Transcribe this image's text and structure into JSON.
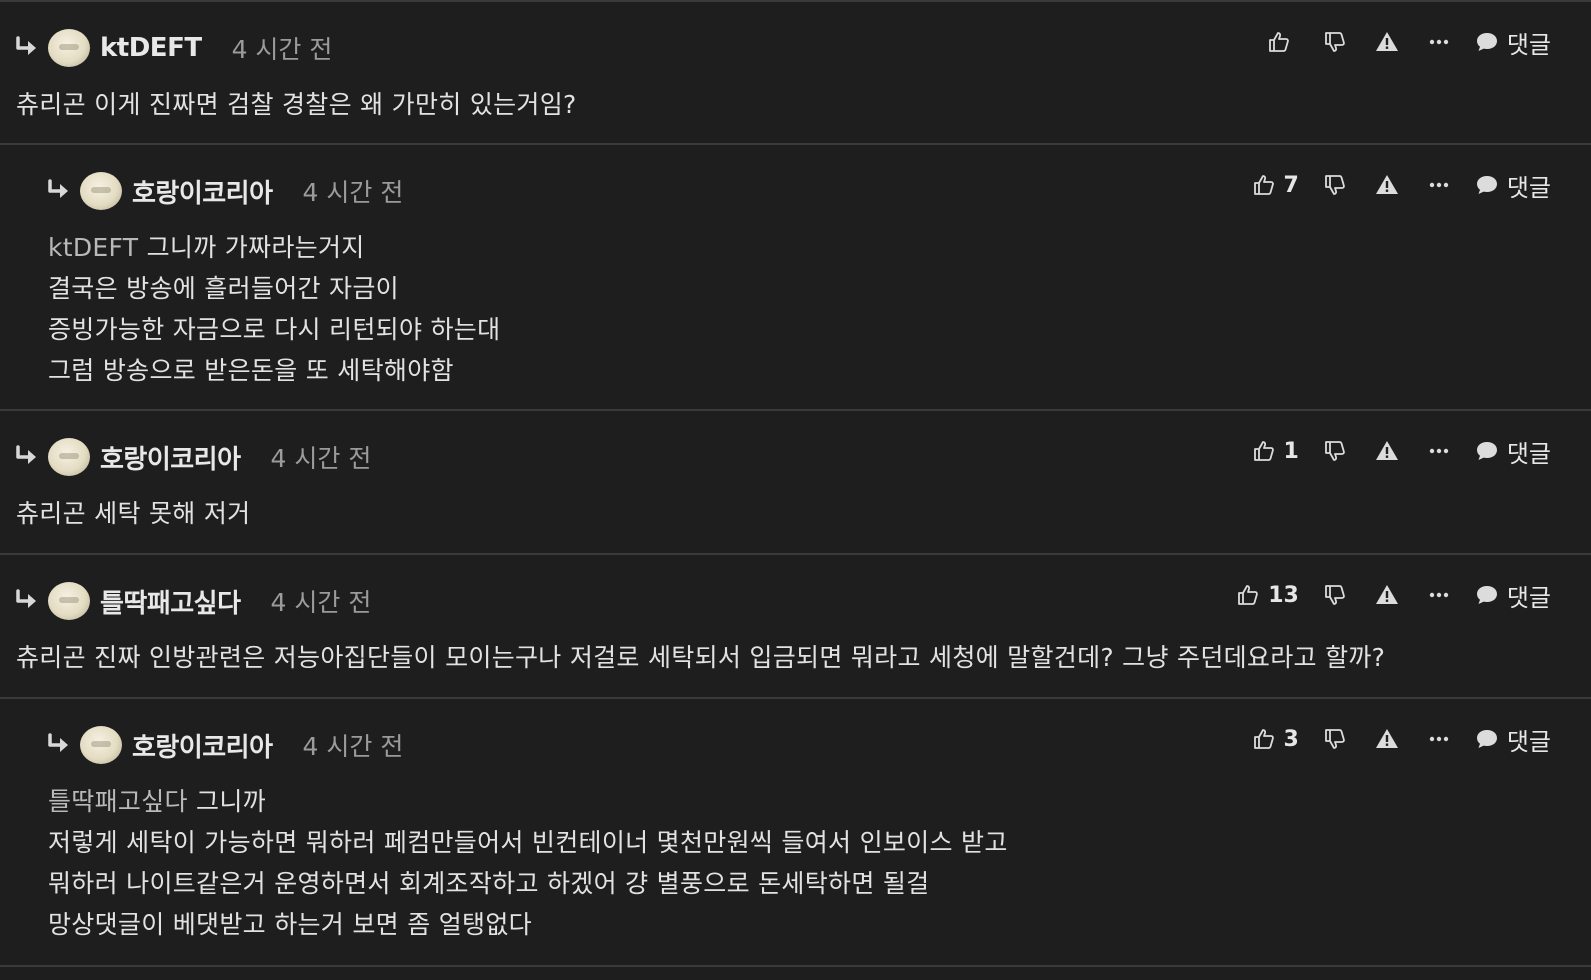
{
  "comments": [
    {
      "author": "ktDEFT",
      "time": "4 시간 전",
      "likes": "",
      "reply_label": "댓글",
      "mention": "",
      "lines": [
        "츄리곤 이게 진짜면 검찰 경찰은 왜 가만히 있는거임?"
      ]
    },
    {
      "author": "호랑이코리아",
      "time": "4 시간 전",
      "likes": "7",
      "reply_label": "댓글",
      "mention": "ktDEFT",
      "lines": [
        " 그니까 가짜라는거지",
        "결국은 방송에 흘러들어간 자금이",
        "증빙가능한 자금으로 다시 리턴되야 하는대",
        "그럼 방송으로 받은돈을 또 세탁해야함"
      ]
    },
    {
      "author": "호랑이코리아",
      "time": "4 시간 전",
      "likes": "1",
      "reply_label": "댓글",
      "mention": "",
      "lines": [
        "츄리곤 세탁 못해 저거"
      ]
    },
    {
      "author": "틀딱패고싶다",
      "time": "4 시간 전",
      "likes": "13",
      "reply_label": "댓글",
      "mention": "",
      "lines": [
        "츄리곤 진짜 인방관련은 저능아집단들이 모이는구나 저걸로 세탁되서 입금되면 뭐라고 세청에 말할건데? 그냥 주던데요라고 할까?"
      ]
    },
    {
      "author": "호랑이코리아",
      "time": "4 시간 전",
      "likes": "3",
      "reply_label": "댓글",
      "mention": "틀딱패고싶다",
      "lines": [
        " 그니까",
        "저렇게 세탁이 가능하면 뭐하러 페컴만들어서 빈컨테이너 몇천만원씩 들여서 인보이스 받고",
        "뭐하러 나이트같은거 운영하면서 회계조작하고 하겠어 걍 별풍으로 돈세탁하면 될걸",
        "망상댓글이 베댓받고 하는거 보면 좀 얼탱없다"
      ]
    }
  ],
  "icons": {
    "reply_arrow": "reply-arrow-icon",
    "like": "thumbs-up-icon",
    "dislike": "thumbs-down-icon",
    "report": "warning-icon",
    "more": "more-icon",
    "reply": "chat-bubble-icon"
  },
  "colors": {
    "background": "#1e1e1e",
    "text": "#e2e2e2",
    "muted": "#9b9b9b",
    "divider": "#3a3a3a"
  }
}
